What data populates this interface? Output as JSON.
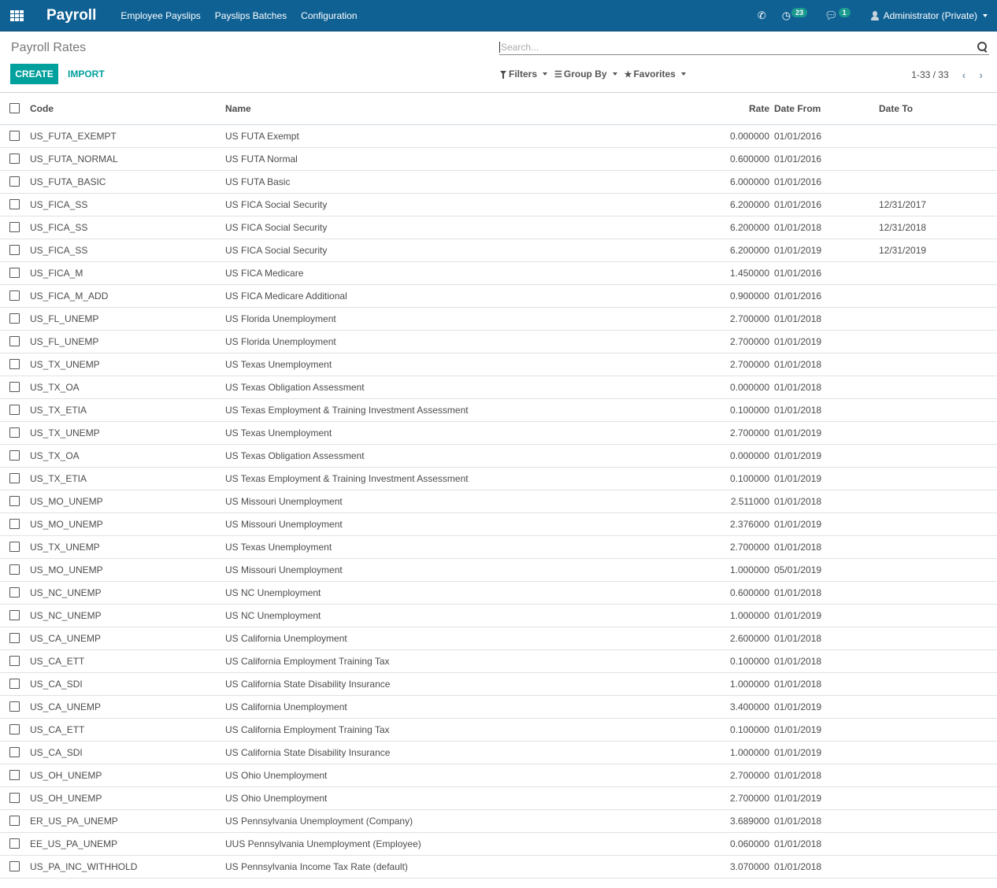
{
  "navbar": {
    "brand": "Payroll",
    "menu": [
      "Employee Payslips",
      "Payslips Batches",
      "Configuration"
    ],
    "activity_count": "23",
    "message_count": "1",
    "user": "Administrator (Private)"
  },
  "control_panel": {
    "title": "Payroll Rates",
    "create_label": "CREATE",
    "import_label": "IMPORT",
    "search_placeholder": "Search...",
    "filters_label": "Filters",
    "groupby_label": "Group By",
    "favorites_label": "Favorites",
    "pager_text": "1-33 / 33"
  },
  "colors": {
    "navbar": "#0f6194",
    "accent": "#00a09d",
    "badge": "#1b9a8f"
  },
  "table": {
    "headers": {
      "code": "Code",
      "name": "Name",
      "rate": "Rate",
      "date_from": "Date From",
      "date_to": "Date To"
    },
    "rows": [
      {
        "code": "US_FUTA_EXEMPT",
        "name": "US FUTA Exempt",
        "rate": "0.000000",
        "date_from": "01/01/2016",
        "date_to": ""
      },
      {
        "code": "US_FUTA_NORMAL",
        "name": "US FUTA Normal",
        "rate": "0.600000",
        "date_from": "01/01/2016",
        "date_to": ""
      },
      {
        "code": "US_FUTA_BASIC",
        "name": "US FUTA Basic",
        "rate": "6.000000",
        "date_from": "01/01/2016",
        "date_to": ""
      },
      {
        "code": "US_FICA_SS",
        "name": "US FICA Social Security",
        "rate": "6.200000",
        "date_from": "01/01/2016",
        "date_to": "12/31/2017"
      },
      {
        "code": "US_FICA_SS",
        "name": "US FICA Social Security",
        "rate": "6.200000",
        "date_from": "01/01/2018",
        "date_to": "12/31/2018"
      },
      {
        "code": "US_FICA_SS",
        "name": "US FICA Social Security",
        "rate": "6.200000",
        "date_from": "01/01/2019",
        "date_to": "12/31/2019"
      },
      {
        "code": "US_FICA_M",
        "name": "US FICA Medicare",
        "rate": "1.450000",
        "date_from": "01/01/2016",
        "date_to": ""
      },
      {
        "code": "US_FICA_M_ADD",
        "name": "US FICA Medicare Additional",
        "rate": "0.900000",
        "date_from": "01/01/2016",
        "date_to": ""
      },
      {
        "code": "US_FL_UNEMP",
        "name": "US Florida Unemployment",
        "rate": "2.700000",
        "date_from": "01/01/2018",
        "date_to": ""
      },
      {
        "code": "US_FL_UNEMP",
        "name": "US Florida Unemployment",
        "rate": "2.700000",
        "date_from": "01/01/2019",
        "date_to": ""
      },
      {
        "code": "US_TX_UNEMP",
        "name": "US Texas Unemployment",
        "rate": "2.700000",
        "date_from": "01/01/2018",
        "date_to": ""
      },
      {
        "code": "US_TX_OA",
        "name": "US Texas Obligation Assessment",
        "rate": "0.000000",
        "date_from": "01/01/2018",
        "date_to": ""
      },
      {
        "code": "US_TX_ETIA",
        "name": "US Texas Employment & Training Investment Assessment",
        "rate": "0.100000",
        "date_from": "01/01/2018",
        "date_to": ""
      },
      {
        "code": "US_TX_UNEMP",
        "name": "US Texas Unemployment",
        "rate": "2.700000",
        "date_from": "01/01/2019",
        "date_to": ""
      },
      {
        "code": "US_TX_OA",
        "name": "US Texas Obligation Assessment",
        "rate": "0.000000",
        "date_from": "01/01/2019",
        "date_to": ""
      },
      {
        "code": "US_TX_ETIA",
        "name": "US Texas Employment & Training Investment Assessment",
        "rate": "0.100000",
        "date_from": "01/01/2019",
        "date_to": ""
      },
      {
        "code": "US_MO_UNEMP",
        "name": "US Missouri Unemployment",
        "rate": "2.511000",
        "date_from": "01/01/2018",
        "date_to": ""
      },
      {
        "code": "US_MO_UNEMP",
        "name": "US Missouri Unemployment",
        "rate": "2.376000",
        "date_from": "01/01/2019",
        "date_to": ""
      },
      {
        "code": "US_TX_UNEMP",
        "name": "US Texas Unemployment",
        "rate": "2.700000",
        "date_from": "01/01/2018",
        "date_to": ""
      },
      {
        "code": "US_MO_UNEMP",
        "name": "US Missouri Unemployment",
        "rate": "1.000000",
        "date_from": "05/01/2019",
        "date_to": ""
      },
      {
        "code": "US_NC_UNEMP",
        "name": "US NC Unemployment",
        "rate": "0.600000",
        "date_from": "01/01/2018",
        "date_to": ""
      },
      {
        "code": "US_NC_UNEMP",
        "name": "US NC Unemployment",
        "rate": "1.000000",
        "date_from": "01/01/2019",
        "date_to": ""
      },
      {
        "code": "US_CA_UNEMP",
        "name": "US California Unemployment",
        "rate": "2.600000",
        "date_from": "01/01/2018",
        "date_to": ""
      },
      {
        "code": "US_CA_ETT",
        "name": "US California Employment Training Tax",
        "rate": "0.100000",
        "date_from": "01/01/2018",
        "date_to": ""
      },
      {
        "code": "US_CA_SDI",
        "name": "US California State Disability Insurance",
        "rate": "1.000000",
        "date_from": "01/01/2018",
        "date_to": ""
      },
      {
        "code": "US_CA_UNEMP",
        "name": "US California Unemployment",
        "rate": "3.400000",
        "date_from": "01/01/2019",
        "date_to": ""
      },
      {
        "code": "US_CA_ETT",
        "name": "US California Employment Training Tax",
        "rate": "0.100000",
        "date_from": "01/01/2019",
        "date_to": ""
      },
      {
        "code": "US_CA_SDI",
        "name": "US California State Disability Insurance",
        "rate": "1.000000",
        "date_from": "01/01/2019",
        "date_to": ""
      },
      {
        "code": "US_OH_UNEMP",
        "name": "US Ohio Unemployment",
        "rate": "2.700000",
        "date_from": "01/01/2018",
        "date_to": ""
      },
      {
        "code": "US_OH_UNEMP",
        "name": "US Ohio Unemployment",
        "rate": "2.700000",
        "date_from": "01/01/2019",
        "date_to": ""
      },
      {
        "code": "ER_US_PA_UNEMP",
        "name": "US Pennsylvania Unemployment (Company)",
        "rate": "3.689000",
        "date_from": "01/01/2018",
        "date_to": ""
      },
      {
        "code": "EE_US_PA_UNEMP",
        "name": "UUS Pennsylvania Unemployment (Employee)",
        "rate": "0.060000",
        "date_from": "01/01/2018",
        "date_to": ""
      },
      {
        "code": "US_PA_INC_WITHHOLD",
        "name": "US Pennsylvania Income Tax Rate (default)",
        "rate": "3.070000",
        "date_from": "01/01/2018",
        "date_to": ""
      }
    ]
  }
}
